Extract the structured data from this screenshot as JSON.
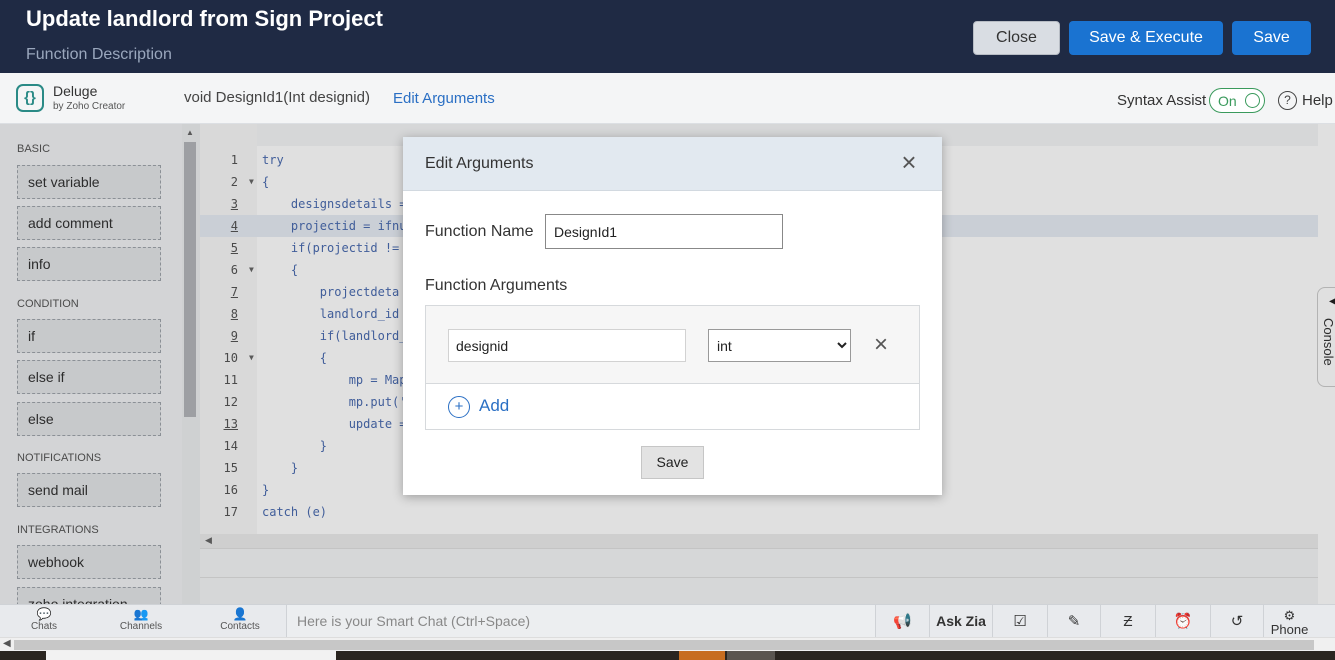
{
  "header": {
    "title": "Update landlord from Sign Project",
    "description": "Function Description",
    "close_label": "Close",
    "save_execute_label": "Save & Execute",
    "save_label": "Save"
  },
  "toolbar": {
    "logo_glyph": "{}",
    "brand": "Deluge",
    "brand_sub": "by Zoho Creator",
    "signature": "void  DesignId1(Int designid)",
    "edit_arguments": "Edit Arguments",
    "syntax_assist": "Syntax Assist",
    "toggle_state": "On",
    "help_glyph": "?",
    "help": "Help"
  },
  "sidebar": {
    "sections": [
      {
        "title": "BASIC",
        "items": [
          "set variable",
          "add comment",
          "info"
        ]
      },
      {
        "title": "CONDITION",
        "items": [
          "if",
          "else if",
          "else"
        ]
      },
      {
        "title": "NOTIFICATIONS",
        "items": [
          "send mail"
        ]
      },
      {
        "title": "INTEGRATIONS",
        "items": [
          "webhook",
          "zoho integration"
        ]
      }
    ]
  },
  "editor": {
    "lines": [
      {
        "n": "1",
        "code": "try"
      },
      {
        "n": "2",
        "code": "{"
      },
      {
        "n": "3",
        "code": "    designsdetails ="
      },
      {
        "n": "4",
        "code": "    projectid = ifnu"
      },
      {
        "n": "5",
        "code": "    if(projectid !="
      },
      {
        "n": "6",
        "code": "    {"
      },
      {
        "n": "7",
        "code": "        projectdeta"
      },
      {
        "n": "8",
        "code": "        landlord_id"
      },
      {
        "n": "9",
        "code": "        if(landlord_"
      },
      {
        "n": "10",
        "code": "        {"
      },
      {
        "n": "11",
        "code": "            mp = Map"
      },
      {
        "n": "12",
        "code": "            mp.put('"
      },
      {
        "n": "13",
        "code": "            update ="
      },
      {
        "n": "14",
        "code": "        }"
      },
      {
        "n": "15",
        "code": "    }"
      },
      {
        "n": "16",
        "code": "}"
      },
      {
        "n": "17",
        "code": "catch (e)"
      }
    ]
  },
  "console": {
    "label": "Console"
  },
  "dialog": {
    "title": "Edit Arguments",
    "close_glyph": "×",
    "function_name_label": "Function Name",
    "function_name_value": "DesignId1",
    "function_arguments_label": "Function Arguments",
    "argument": {
      "name": "designid",
      "type": "int"
    },
    "type_options": [
      "int"
    ],
    "delete_glyph": "×",
    "add_glyph": "+",
    "add_label": "Add",
    "save_label": "Save"
  },
  "bottombar": {
    "chats": "Chats",
    "channels": "Channels",
    "contacts": "Contacts",
    "smart_chat_placeholder": "Here is your Smart Chat (Ctrl+Space)",
    "ask_zia": "Ask Zia",
    "phone": "Phone"
  }
}
